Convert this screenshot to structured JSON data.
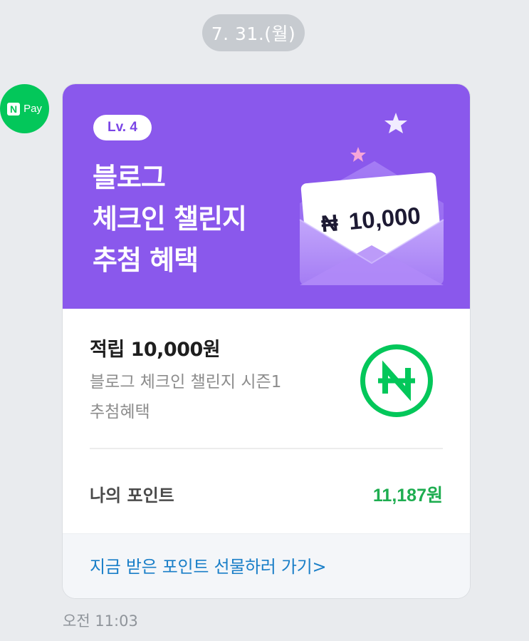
{
  "chat": {
    "date": "7. 31.(월)",
    "time": "오전 11:03"
  },
  "sender": {
    "avatar_badge": "N",
    "avatar_text": "Pay",
    "brand_color": "#03c75a"
  },
  "banner": {
    "level_badge": "Lv. 4",
    "title_lines": [
      "블로그",
      "체크인 챌린지",
      "추첨 혜택"
    ],
    "envelope_amount": "10,000",
    "background_color": "#8a58ec"
  },
  "reward": {
    "title": "적립 10,000원",
    "description": "블로그 체크인 챌린지 시즌1 추첨혜택",
    "icon": "naver-pay-coin-icon"
  },
  "points": {
    "label": "나의 포인트",
    "value": "11,187원",
    "accent_color": "#1ead50"
  },
  "action": {
    "link_label": "지금 받은 포인트 선물하러 가기>",
    "link_color": "#1a7fc8"
  }
}
